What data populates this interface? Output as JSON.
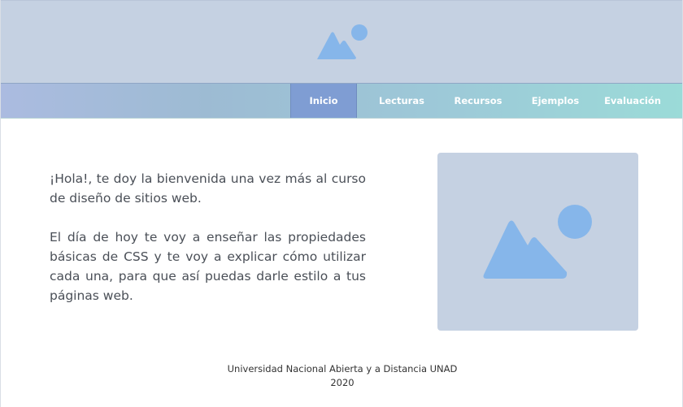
{
  "header": {
    "banner_icon": "image-placeholder-icon"
  },
  "nav": {
    "items": [
      {
        "label": "Inicio",
        "active": true
      },
      {
        "label": "Lecturas",
        "active": false
      },
      {
        "label": "Recursos",
        "active": false
      },
      {
        "label": "Ejemplos",
        "active": false
      },
      {
        "label": "Evaluación",
        "active": false
      }
    ]
  },
  "main": {
    "paragraphs": [
      "¡Hola!, te doy la bienvenida una vez más al curso de diseño de sitios web.",
      "El día de hoy te voy a enseñar las propiedades básicas de CSS y te voy a explicar cómo utilizar cada una, para que así puedas darle estilo a tus páginas web."
    ],
    "image_icon": "image-placeholder-icon"
  },
  "footer": {
    "line1": "Universidad Nacional Abierta y a Distancia UNAD",
    "line2": "2020"
  },
  "colors": {
    "placeholder_bg": "#c5d1e2",
    "placeholder_icon": "#86b6ea",
    "nav_active": "#7f9dd3"
  }
}
